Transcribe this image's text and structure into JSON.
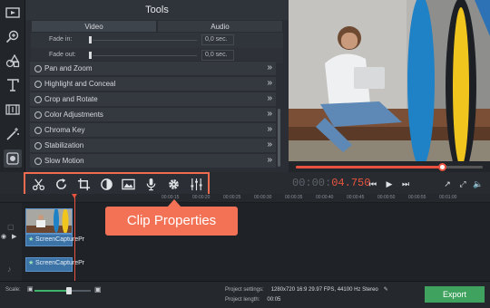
{
  "tools_panel": {
    "title": "Tools",
    "tabs": [
      "Video",
      "Audio"
    ],
    "fade_in": {
      "label": "Fade in:",
      "value": "0,0 sec."
    },
    "fade_out": {
      "label": "Fade out:",
      "value": "0,0 sec."
    },
    "items": [
      "Pan and Zoom",
      "Highlight and Conceal",
      "Crop and Rotate",
      "Color Adjustments",
      "Chroma Key",
      "Stabilization",
      "Slow Motion"
    ]
  },
  "left_tools": [
    "media-icon",
    "zoom-icon",
    "filters-icon",
    "titles-icon",
    "transitions-icon",
    "magic-icon",
    "record-icon"
  ],
  "edit_tools": [
    "scissors-icon",
    "rotate-icon",
    "crop-icon",
    "color-icon",
    "image-icon",
    "microphone-icon",
    "gear-icon",
    "equalizer-icon"
  ],
  "timecode": {
    "dim": "00:00:",
    "hot": "04.750"
  },
  "preview": {
    "progress_fraction": 0.78
  },
  "ruler_ticks": [
    "00:00:15",
    "00:00:20",
    "00:00:25",
    "00:00:30",
    "00:00:35",
    "00:00:40",
    "00:00:45",
    "00:00:50",
    "00:00:55",
    "00:01:00"
  ],
  "callout": {
    "label": "Clip Properties"
  },
  "clips": {
    "video_title": "ScreenCapturePr",
    "audio_title": "ScreenCapturePr"
  },
  "bottom": {
    "scale_label": "Scale:",
    "scale_fraction": 0.62,
    "project_settings_label": "Project settings:",
    "project_settings_value": "1280x720 16:9 29.97 FPS, 44100 Hz Stereo",
    "project_length_label": "Project length:",
    "project_length_value": "00:05",
    "export_label": "Export"
  },
  "colors": {
    "accent": "#e8533f",
    "callout": "#f37255",
    "export": "#3fa35f",
    "clip": "#3c73a6"
  }
}
